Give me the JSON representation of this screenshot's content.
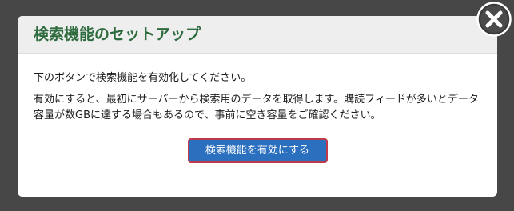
{
  "dialog": {
    "title": "検索機能のセットアップ",
    "line1": "下のボタンで検索機能を有効化してください。",
    "line2": "有効にすると、最初にサーバーから検索用のデータを取得します。購読フィードが多いとデータ容量が数GBに達する場合もあるので、事前に空き容量をご確認ください。",
    "button_label": "検索機能を有効にする",
    "close_icon": "close-icon"
  },
  "colors": {
    "backdrop": "#474747",
    "title": "#2e6b3e",
    "button": "#2b6fbf",
    "button_border": "#c0394a"
  }
}
